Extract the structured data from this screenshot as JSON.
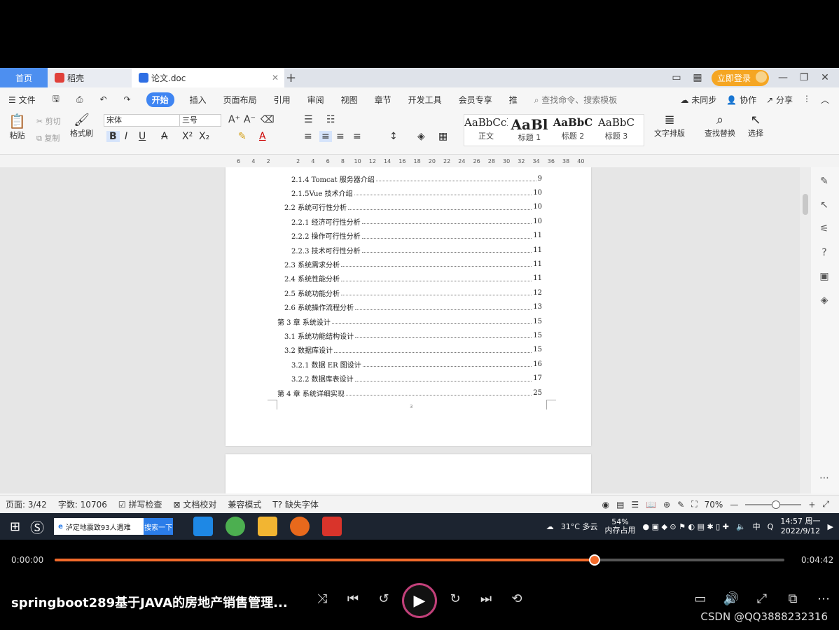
{
  "tabs": {
    "home": "首页",
    "daoke": "稻壳",
    "doc": "论文.doc",
    "plus": "+",
    "login": "立即登录"
  },
  "menu": {
    "file": "文件",
    "items": [
      "开始",
      "插入",
      "页面布局",
      "引用",
      "审阅",
      "视图",
      "章节",
      "开发工具",
      "会员专享",
      "推"
    ],
    "search": "查找命令、搜索模板",
    "sync": "未同步",
    "collab": "协作",
    "share": "分享"
  },
  "ribbon": {
    "paste": "粘贴",
    "cut": "剪切",
    "copy": "复制",
    "format_painter": "格式刷",
    "font": "宋体",
    "size": "三号",
    "styles": [
      {
        "sample": "AaBbCcI",
        "name": "正文"
      },
      {
        "sample": "AaBl",
        "name": "标题 1"
      },
      {
        "sample": "AaBbC",
        "name": "标题 2"
      },
      {
        "sample": "AaBbC",
        "name": "标题 3"
      }
    ],
    "text_layout": "文字排版",
    "find_replace": "查找替换",
    "select": "选择"
  },
  "ruler": [
    "6",
    "4",
    "2",
    "",
    "2",
    "4",
    "6",
    "8",
    "10",
    "12",
    "14",
    "16",
    "18",
    "20",
    "22",
    "24",
    "26",
    "28",
    "30",
    "32",
    "34",
    "36",
    "38",
    "40"
  ],
  "toc": [
    {
      "text": "2.1.4 Tomcat 服务器介绍",
      "page": "9",
      "level": 3
    },
    {
      "text": "2.1.5Vue 技术介绍",
      "page": "10",
      "level": 3
    },
    {
      "text": "2.2 系统可行性分析",
      "page": "10",
      "level": 2
    },
    {
      "text": "2.2.1 经济可行性分析",
      "page": "10",
      "level": 3
    },
    {
      "text": "2.2.2 操作可行性分析",
      "page": "11",
      "level": 3
    },
    {
      "text": "2.2.3 技术可行性分析",
      "page": "11",
      "level": 3
    },
    {
      "text": "2.3 系统需求分析",
      "page": "11",
      "level": 2
    },
    {
      "text": "2.4 系统性能分析",
      "page": "11",
      "level": 2
    },
    {
      "text": "2.5 系统功能分析",
      "page": "12",
      "level": 2
    },
    {
      "text": "2.6 系统操作流程分析",
      "page": "13",
      "level": 2
    },
    {
      "text": "第 3 章  系统设计",
      "page": "15",
      "level": 1
    },
    {
      "text": "3.1 系统功能结构设计",
      "page": "15",
      "level": 2
    },
    {
      "text": "3.2 数据库设计",
      "page": "15",
      "level": 2
    },
    {
      "text": "3.2.1 数据 ER 图设计",
      "page": "16",
      "level": 3
    },
    {
      "text": "3.2.2 数据库表设计",
      "page": "17",
      "level": 3
    },
    {
      "text": "第 4 章  系统详细实现",
      "page": "25",
      "level": 1
    }
  ],
  "page_number": "3",
  "status": {
    "page": "页面: 3/42",
    "words": "字数: 10706",
    "spell": "拼写检查",
    "proof": "文档校对",
    "compat": "兼容模式",
    "missing_font": "缺失字体",
    "zoom": "70%"
  },
  "taskbar": {
    "search_text": "泸定地震致93人遇难",
    "search_btn": "搜索一下",
    "weather": "31°C 多云",
    "memory_pct": "54%",
    "memory_label": "内存占用",
    "ime": "中",
    "time": "14:57 周一",
    "date": "2022/9/12"
  },
  "player": {
    "current": "0:00:00",
    "duration": "0:04:42",
    "progress": 0.74,
    "title": "springboot289基于JAVA的房地产销售管理...",
    "watermark": "CSDN @QQ3888232316"
  }
}
